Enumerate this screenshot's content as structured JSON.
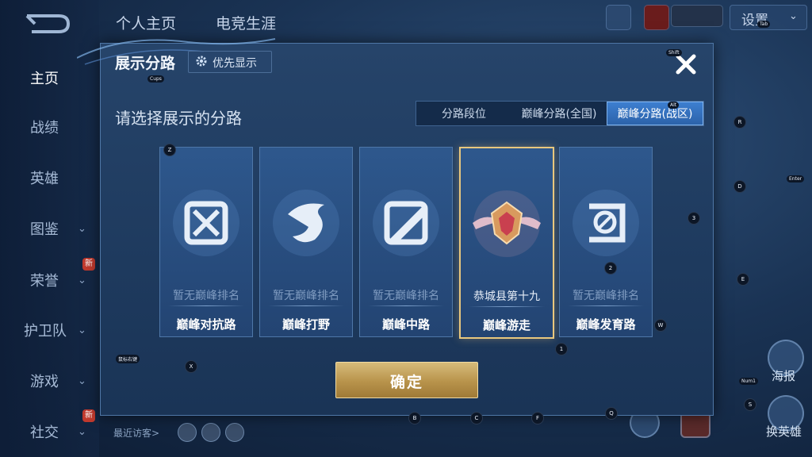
{
  "background": {
    "top_tabs": [
      "个人主页",
      "电竞生涯"
    ],
    "nav": [
      {
        "label": "主页",
        "active": true,
        "chevron": false,
        "badge": ""
      },
      {
        "label": "战绩",
        "active": false,
        "chevron": false,
        "badge": ""
      },
      {
        "label": "英雄",
        "active": false,
        "chevron": false,
        "badge": ""
      },
      {
        "label": "图鉴",
        "active": false,
        "chevron": true,
        "badge": ""
      },
      {
        "label": "荣誉",
        "active": false,
        "chevron": true,
        "badge": "新"
      },
      {
        "label": "护卫队",
        "active": false,
        "chevron": true,
        "badge": ""
      },
      {
        "label": "游戏",
        "active": false,
        "chevron": true,
        "badge": ""
      },
      {
        "label": "社交",
        "active": false,
        "chevron": true,
        "badge": "新"
      }
    ],
    "settings_label": "设置",
    "recent_visitors_label": "最近访客>",
    "right_buttons": [
      "海报",
      "换英雄"
    ]
  },
  "modal": {
    "title": "展示分路",
    "priority_label": "优先显示",
    "subtitle": "请选择展示的分路",
    "tabs": [
      "分路段位",
      "巅峰分路(全国)",
      "巅峰分路(战区)"
    ],
    "selected_tab": 2,
    "cards": [
      {
        "rank": "暂无巅峰排名",
        "lane": "巅峰对抗路",
        "icon": "sword-lane-icon",
        "selected": false
      },
      {
        "rank": "暂无巅峰排名",
        "lane": "巅峰打野",
        "icon": "dragon-jungle-icon",
        "selected": false
      },
      {
        "rank": "暂无巅峰排名",
        "lane": "巅峰中路",
        "icon": "slash-mid-icon",
        "selected": false
      },
      {
        "rank": "恭城县第十九",
        "lane": "巅峰游走",
        "icon": "winged-rank-emblem-icon",
        "selected": true
      },
      {
        "rank": "暂无巅峰排名",
        "lane": "巅峰发育路",
        "icon": "target-carry-icon",
        "selected": false
      }
    ],
    "confirm_label": "确定"
  },
  "key_hints": [
    "Z",
    "X",
    "1",
    "W",
    "B",
    "C",
    "F",
    "Q",
    "R",
    "D",
    "3",
    "2",
    "E",
    "S",
    "Cups",
    "Shift",
    "Alt",
    "Tab",
    "Enter",
    "Num1",
    "鼠标右键"
  ],
  "colors": {
    "accent_blue": "#2c63aa",
    "gold": "#c9a45e",
    "panel": "#1e3a5e"
  }
}
